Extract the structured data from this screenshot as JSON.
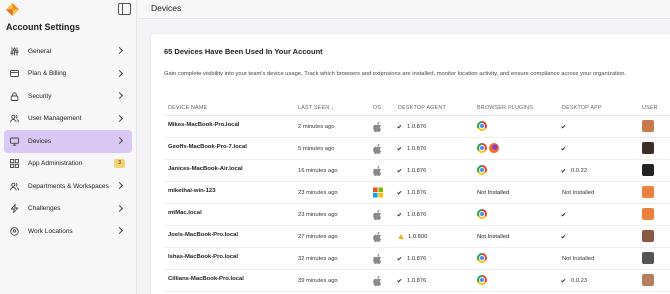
{
  "sidebar": {
    "title": "Account Settings",
    "items": [
      {
        "label": "General",
        "icon": "sliders-icon"
      },
      {
        "label": "Plan & Billing",
        "icon": "credit-card-icon"
      },
      {
        "label": "Security",
        "icon": "lock-icon"
      },
      {
        "label": "User Management",
        "icon": "users-icon"
      },
      {
        "label": "Devices",
        "icon": "monitor-icon",
        "active": true
      },
      {
        "label": "App Administration",
        "icon": "grid-icon",
        "badge": "3"
      },
      {
        "label": "Departments & Workspaces",
        "icon": "users-icon"
      },
      {
        "label": "Challenges",
        "icon": "bolt-icon"
      },
      {
        "label": "Work Locations",
        "icon": "map-pin-icon"
      }
    ]
  },
  "header": {
    "title": "Devices"
  },
  "card": {
    "title": "65 Devices Have Been Used In Your Account",
    "description": "Gain complete visibility into your team's device usage. Track which browsers and extensions are installed, monitor location activity, and ensure compliance across your organization."
  },
  "table": {
    "columns": [
      "DEVICE NAME",
      "LAST SEEN",
      "OS",
      "DESKTOP AGENT",
      "BROWSER PLUGINS",
      "DESKTOP APP",
      "USER"
    ],
    "sort_indicator": "↓",
    "rows": [
      {
        "name": "Mikes-MacBook-Pro.local",
        "seen": "2 minutes ago",
        "os": "apple",
        "agent": "1.0.876",
        "agent_status": "check",
        "plugins": [
          "chrome"
        ],
        "app": "",
        "app_status": "check",
        "user_color": "#c97a4a"
      },
      {
        "name": "Geoffs-MacBook-Pro-7.local",
        "seen": "5 minutes ago",
        "os": "apple",
        "agent": "1.0.876",
        "agent_status": "check",
        "plugins": [
          "chrome",
          "firefox"
        ],
        "app": "",
        "app_status": "check",
        "user_color": "#3b2d2a"
      },
      {
        "name": "Janices-MacBook-Air.local",
        "seen": "16 minutes ago",
        "os": "apple",
        "agent": "1.0.876",
        "agent_status": "check",
        "plugins": [
          "chrome"
        ],
        "app": "0.0.22",
        "app_status": "check",
        "user_color": "#222222"
      },
      {
        "name": "mikethai-win-123",
        "seen": "23 minutes ago",
        "os": "windows",
        "agent": "1.0.876",
        "agent_status": "check",
        "plugins_text": "Not Installed",
        "plugins": [],
        "app": "Not Installed",
        "app_status": "",
        "user_color": "#e8823c"
      },
      {
        "name": "mtMac.local",
        "seen": "23 minutes ago",
        "os": "apple",
        "agent": "1.0.876",
        "agent_status": "check",
        "plugins": [
          "chrome"
        ],
        "app": "",
        "app_status": "check",
        "user_color": "#e8823c"
      },
      {
        "name": "Joels-MacBook-Pro.local",
        "seen": "27 minutes ago",
        "os": "apple",
        "agent": "1.0.800",
        "agent_status": "warn",
        "plugins_text": "Not Installed",
        "plugins": [],
        "app": "",
        "app_status": "check",
        "user_color": "#8a5a44"
      },
      {
        "name": "Ishas-MacBook-Pro.local",
        "seen": "32 minutes ago",
        "os": "apple",
        "agent": "1.0.876",
        "agent_status": "check",
        "plugins": [
          "chrome"
        ],
        "app": "Not Installed",
        "app_status": "",
        "user_color": "#555555"
      },
      {
        "name": "Cillians-MacBook-Pro.local",
        "seen": "39 minutes ago",
        "os": "apple",
        "agent": "1.0.876",
        "agent_status": "check",
        "plugins": [
          "chrome"
        ],
        "app": "0.0.23",
        "app_status": "check",
        "user_color": "#b08060"
      }
    ]
  },
  "colors": {
    "accent_active": "#d9c8f3",
    "badge": "#f6d271",
    "logo_orange": "#f08a24",
    "logo_yellow": "#f6c342"
  }
}
